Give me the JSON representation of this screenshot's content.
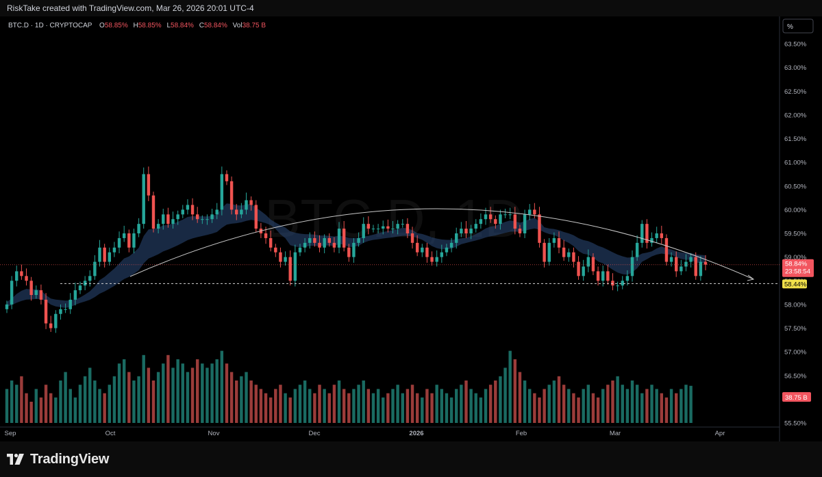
{
  "caption": "RiskTake created with TradingView.com, Mar 26, 2026 20:01 UTC-4",
  "brand": {
    "name": "TradingView"
  },
  "legend": {
    "symbol": "BTC.D · 1D · CRYPTOCAP",
    "open_label": "O",
    "open": "58.85%",
    "high_label": "H",
    "high": "58.85%",
    "low_label": "L",
    "low": "58.84%",
    "close_label": "C",
    "close": "58.84%",
    "vol_label": "Vol",
    "vol": "38.75 B"
  },
  "watermark": "BTC.D, 1D",
  "scale_mode": "%",
  "price_tag": {
    "value": "58.84%",
    "countdown": "23:58:54"
  },
  "level_tag": "58.44%",
  "volume_tag": "38.75 B",
  "colors": {
    "up": "#26a69a",
    "down": "#ef5350",
    "vol_up": "#1a6b62",
    "vol_down": "#9b3c3a",
    "ema": "#2b4a7a",
    "level": "#f0e04a",
    "background": "#000000"
  },
  "chart_data": {
    "type": "candlestick",
    "symbol": "BTC.D",
    "interval": "1D",
    "y_axis_ticks": [
      "63.50%",
      "63.00%",
      "62.50%",
      "62.00%",
      "61.50%",
      "61.00%",
      "60.50%",
      "60.00%",
      "59.50%",
      "59.00%",
      "58.50%",
      "58.00%",
      "57.50%",
      "57.00%",
      "56.50%",
      "56.00%",
      "55.50%"
    ],
    "x_axis_labels": [
      "Sep",
      "Oct",
      "Nov",
      "Dec",
      "2026",
      "Feb",
      "Mar",
      "Apr"
    ],
    "ylim": [
      55.5,
      63.5
    ],
    "grid": false,
    "horizontal_level": 58.44,
    "last_close": 58.84,
    "close_series": [
      58.0,
      58.5,
      58.7,
      58.6,
      58.5,
      58.2,
      58.3,
      58.1,
      57.6,
      57.5,
      57.8,
      57.9,
      57.9,
      58.1,
      58.3,
      58.4,
      58.5,
      58.6,
      58.9,
      59.2,
      58.9,
      59.1,
      59.2,
      59.4,
      59.5,
      59.2,
      59.5,
      59.7,
      60.75,
      60.3,
      59.6,
      59.7,
      59.9,
      59.7,
      59.8,
      59.9,
      60.0,
      60.1,
      59.9,
      59.8,
      59.8,
      59.8,
      59.9,
      60.0,
      60.75,
      60.6,
      60.0,
      59.9,
      60.0,
      60.2,
      60.1,
      59.6,
      59.5,
      59.4,
      59.2,
      59.1,
      58.9,
      59.0,
      58.5,
      59.1,
      59.2,
      59.3,
      59.4,
      59.3,
      59.2,
      59.4,
      59.3,
      59.2,
      59.6,
      59.2,
      59.0,
      59.3,
      59.4,
      59.7,
      59.6,
      59.6,
      59.6,
      59.65,
      59.6,
      59.6,
      59.7,
      59.7,
      59.5,
      59.3,
      59.1,
      59.2,
      59.0,
      58.9,
      59.0,
      59.1,
      59.2,
      59.3,
      59.5,
      59.6,
      59.5,
      59.6,
      59.7,
      59.8,
      59.9,
      59.8,
      59.7,
      59.9,
      59.9,
      59.9,
      59.6,
      59.5,
      59.9,
      60.0,
      59.9,
      59.3,
      58.9,
      59.3,
      59.4,
      59.2,
      59.0,
      59.1,
      58.9,
      58.6,
      58.8,
      59.0,
      58.7,
      58.5,
      58.7,
      58.5,
      58.4,
      58.4,
      58.5,
      58.6,
      59.0,
      59.3,
      59.7,
      59.3,
      59.4,
      59.5,
      59.4,
      58.9,
      59.0,
      58.7,
      58.8,
      58.9,
      59.0,
      58.6,
      58.9,
      58.84
    ],
    "volume_series": [
      38,
      40,
      39,
      41,
      37,
      35,
      38,
      36,
      39,
      37,
      36,
      40,
      42,
      38,
      36,
      39,
      41,
      43,
      40,
      38,
      37,
      39,
      41,
      44,
      45,
      42,
      40,
      41,
      46,
      43,
      40,
      42,
      44,
      46,
      43,
      45,
      44,
      42,
      43,
      45,
      44,
      43,
      44,
      45,
      47,
      44,
      42,
      40,
      41,
      42,
      40,
      39,
      38,
      37,
      36,
      38,
      39,
      37,
      36,
      38,
      39,
      40,
      38,
      37,
      39,
      38,
      37,
      39,
      40,
      38,
      37,
      38,
      39,
      40,
      38,
      37,
      38,
      36,
      37,
      38,
      39,
      37,
      38,
      39,
      37,
      36,
      38,
      37,
      39,
      38,
      37,
      36,
      38,
      39,
      40,
      38,
      37,
      36,
      38,
      39,
      40,
      41,
      43,
      47,
      45,
      42,
      40,
      38,
      37,
      36,
      38,
      39,
      40,
      41,
      39,
      38,
      37,
      36,
      38,
      39,
      37,
      36,
      38,
      39,
      40,
      41,
      39,
      38,
      40,
      39,
      37,
      38,
      39,
      38,
      37,
      36,
      38,
      37,
      38,
      39,
      38.75
    ]
  }
}
